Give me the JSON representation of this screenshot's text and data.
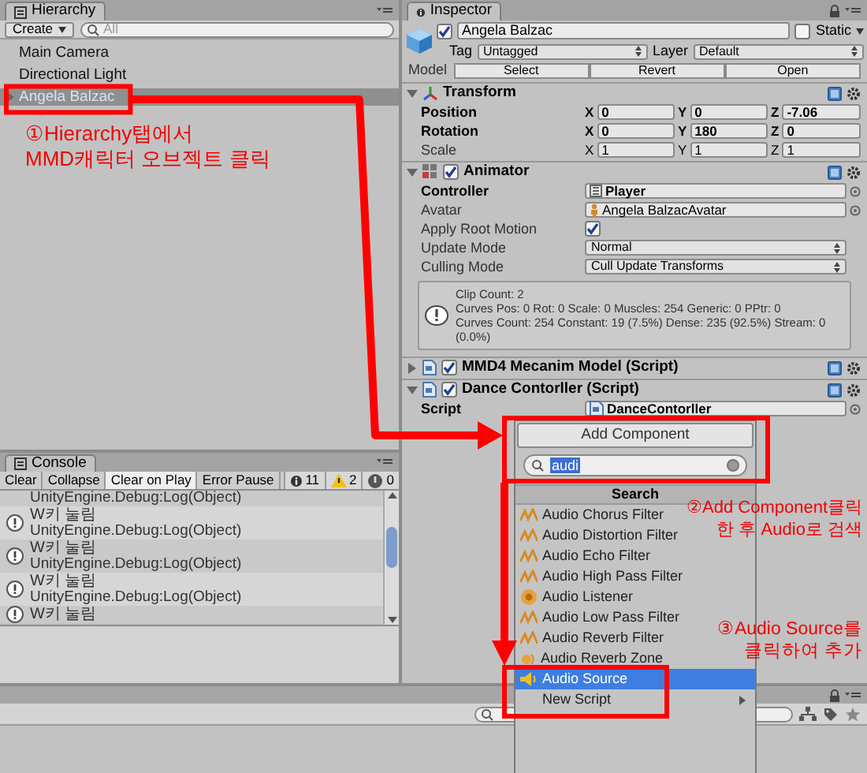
{
  "hierarchy": {
    "tab": "Hierarchy",
    "create": "Create",
    "search_placeholder": "All",
    "items": [
      {
        "label": "Main Camera",
        "selected": false
      },
      {
        "label": "Directional Light",
        "selected": false
      },
      {
        "label": "Angela Balzac",
        "selected": true,
        "expanded": false
      }
    ]
  },
  "console": {
    "tab": "Console",
    "buttons": [
      {
        "label": "Clear",
        "on": false
      },
      {
        "label": "Collapse",
        "on": false
      },
      {
        "label": "Clear on Play",
        "on": true
      },
      {
        "label": "Error Pause",
        "on": false
      }
    ],
    "counts": [
      {
        "kind": "info",
        "count": "11"
      },
      {
        "kind": "warning",
        "count": "2"
      },
      {
        "kind": "error",
        "count": "0"
      }
    ],
    "entries": [
      {
        "trace": "UnityEngine.Debug:Log(Object)"
      },
      {
        "message": "W키 눌림",
        "trace": "UnityEngine.Debug:Log(Object)"
      },
      {
        "message": "W키 눌림",
        "trace": "UnityEngine.Debug:Log(Object)"
      },
      {
        "message": "W키 눌림",
        "trace": "UnityEngine.Debug:Log(Object)"
      },
      {
        "message": "W키 눌림"
      }
    ]
  },
  "inspector": {
    "tab": "Inspector",
    "object": {
      "active": true,
      "name": "Angela Balzac",
      "static": false,
      "static_label": "Static",
      "tag_label": "Tag",
      "tag": "Untagged",
      "layer_label": "Layer",
      "layer": "Default",
      "model_label": "Model",
      "model_buttons": [
        "Select",
        "Revert",
        "Open"
      ]
    },
    "components": [
      {
        "kind": "transform",
        "title": "Transform",
        "expanded": true,
        "properties": [
          {
            "kind": "vector",
            "label": "Position",
            "bold": true,
            "values": [
              {
                "axis": "X",
                "value": "0"
              },
              {
                "axis": "Y",
                "value": "0"
              },
              {
                "axis": "Z",
                "value": "-7.06"
              }
            ]
          },
          {
            "kind": "vector",
            "label": "Rotation",
            "bold": true,
            "values": [
              {
                "axis": "X",
                "value": "0"
              },
              {
                "axis": "Y",
                "value": "180"
              },
              {
                "axis": "Z",
                "value": "0"
              }
            ]
          },
          {
            "kind": "vector",
            "label": "Scale",
            "bold": false,
            "values": [
              {
                "axis": "X",
                "value": "1"
              },
              {
                "axis": "Y",
                "value": "1"
              },
              {
                "axis": "Z",
                "value": "1"
              }
            ]
          }
        ]
      },
      {
        "kind": "animator",
        "title": "Animator",
        "enabled": true,
        "expanded": true,
        "properties": [
          {
            "kind": "object",
            "label": "Controller",
            "bold": true,
            "value": "Player"
          },
          {
            "kind": "object",
            "label": "Avatar",
            "bold": false,
            "value": "Angela BalzacAvatar"
          },
          {
            "kind": "check",
            "label": "Apply Root Motion",
            "bold": false,
            "checked": true
          },
          {
            "kind": "dropdown",
            "label": "Update Mode",
            "bold": false,
            "value": "Normal"
          },
          {
            "kind": "dropdown",
            "label": "Culling Mode",
            "bold": false,
            "value": "Cull Update Transforms"
          },
          {
            "kind": "info",
            "lines": [
              "Clip Count: 2",
              "Curves Pos: 0 Rot: 0 Scale: 0 Muscles: 254 Generic: 0 PPtr: 0",
              "Curves Count: 254 Constant: 19 (7.5%) Dense: 235 (92.5%) Stream: 0 (0.0%)"
            ]
          }
        ]
      },
      {
        "kind": "script",
        "title": "MMD4 Mecanim Model (Script)",
        "enabled": true,
        "expanded": false
      },
      {
        "kind": "script",
        "title": "Dance Contorller (Script)",
        "enabled": true,
        "expanded": true,
        "properties": [
          {
            "kind": "object",
            "label": "Script",
            "bold": true,
            "value": "DanceContorller"
          }
        ]
      }
    ]
  },
  "add_component": {
    "button": "Add Component",
    "search": {
      "value": "audi",
      "text_selected": true
    },
    "header": "Search",
    "items": [
      {
        "kind": "filter",
        "label": "Audio Chorus Filter",
        "selected": false
      },
      {
        "kind": "filter",
        "label": "Audio Distortion Filter",
        "selected": false
      },
      {
        "kind": "filter",
        "label": "Audio Echo Filter",
        "selected": false
      },
      {
        "kind": "filter",
        "label": "Audio High Pass Filter",
        "selected": false
      },
      {
        "kind": "listener",
        "label": "Audio Listener",
        "selected": false
      },
      {
        "kind": "filter",
        "label": "Audio Low Pass Filter",
        "selected": false
      },
      {
        "kind": "filter",
        "label": "Audio Reverb Filter",
        "selected": false
      },
      {
        "kind": "zone",
        "label": "Audio Reverb Zone",
        "selected": false
      },
      {
        "kind": "source",
        "label": "Audio Source",
        "selected": true
      },
      {
        "kind": "submenu",
        "label": "New Script",
        "selected": false
      }
    ]
  },
  "annotations": [
    {
      "lines": [
        "①Hierarchy탭에서",
        "MMD캐릭터 오브젝트 클릭"
      ]
    },
    {
      "lines": [
        "②Add Component클릭",
        "한 후 Audio로 검색"
      ]
    },
    {
      "lines": [
        "③Audio Source를",
        "클릭하여 추가"
      ]
    }
  ]
}
